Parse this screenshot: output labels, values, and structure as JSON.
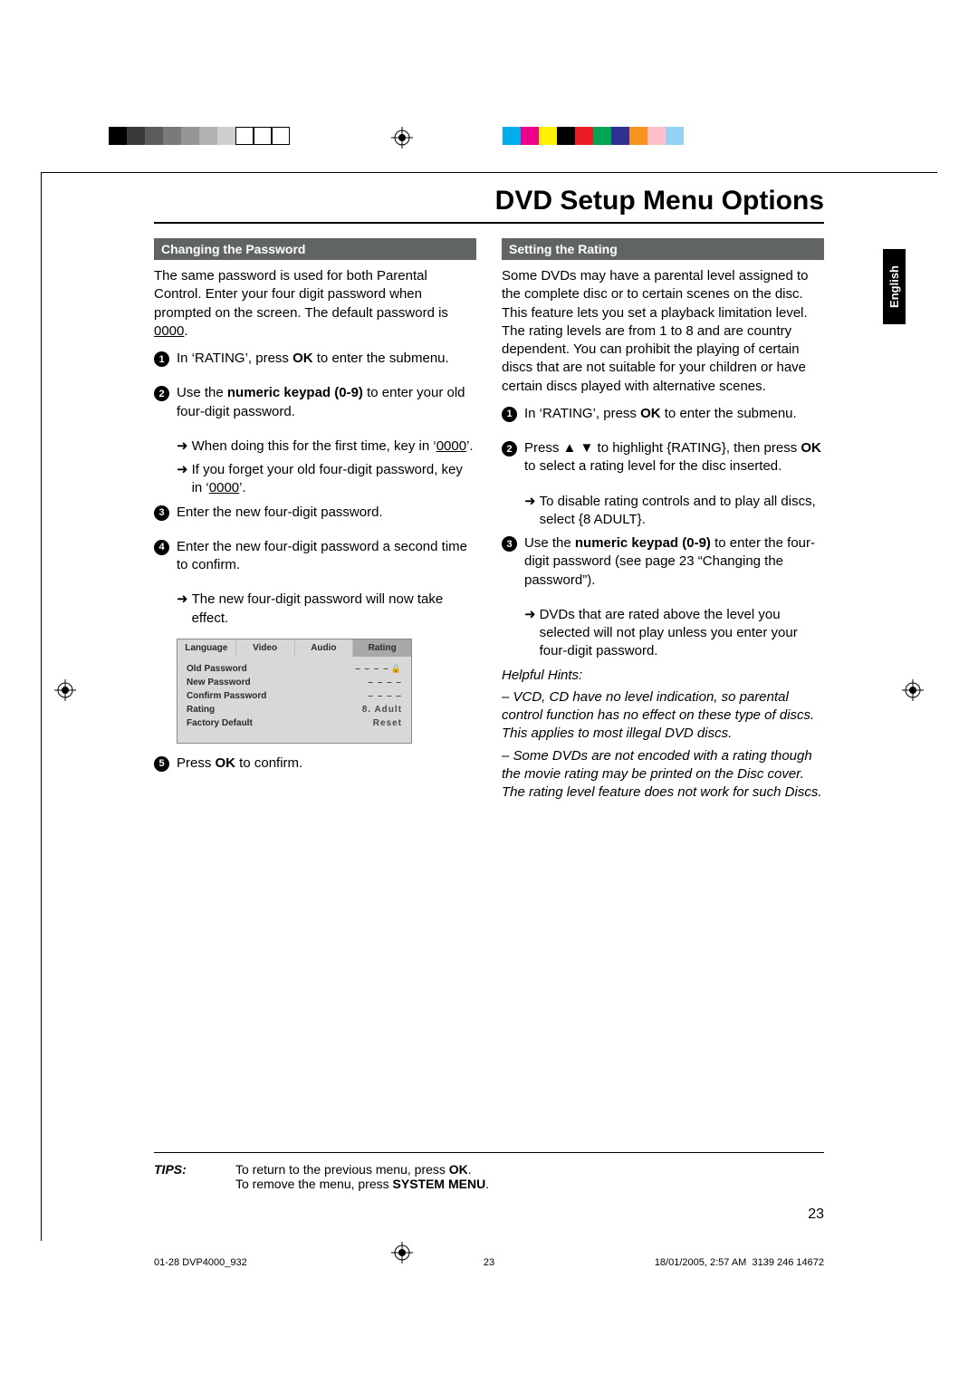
{
  "title": "DVD Setup Menu Options",
  "language_tab": "English",
  "left": {
    "heading": "Changing the Password",
    "intro_a": "The same password is used for both Parental Control. Enter your four digit password when prompted on the screen. The default password is ",
    "intro_default": "0000",
    "intro_b": ".",
    "step1_a": "In ‘RATING’, press ",
    "step1_ok": "OK",
    "step1_b": " to enter the submenu.",
    "step2_a": "Use the ",
    "step2_bold": "numeric keypad (0-9)",
    "step2_b": " to enter your old four-digit password.",
    "step2_sub1_a": "When doing this for the first time, key in ‘",
    "step2_sub1_u": "0000",
    "step2_sub1_b": "’.",
    "step2_sub2_a": "If you forget your old four-digit password, key in ‘",
    "step2_sub2_u": "0000",
    "step2_sub2_b": "’.",
    "step3": "Enter the new four-digit password.",
    "step4": "Enter the new four-digit password a second time to confirm.",
    "step4_sub": "The new four-digit password will now take effect.",
    "step5_a": "Press ",
    "step5_ok": "OK",
    "step5_b": " to confirm."
  },
  "osd": {
    "tabs": [
      "Language",
      "Video",
      "Audio",
      "Rating"
    ],
    "rows": [
      {
        "k": "Old Password",
        "v": "– – – –",
        "lock": true
      },
      {
        "k": "New Password",
        "v": "– – – –"
      },
      {
        "k": "Confirm Password",
        "v": "– – – –"
      },
      {
        "k": "Rating",
        "v": "8. Adult"
      },
      {
        "k": "Factory Default",
        "v": "Reset"
      }
    ]
  },
  "right": {
    "heading": "Setting the Rating",
    "intro": "Some DVDs may have a parental level assigned to the complete disc or to certain scenes on the disc. This feature lets you set a playback limitation level. The rating levels are from 1 to 8 and are country dependent. You can prohibit the playing of certain discs that are not suitable for your children or have certain discs played with alternative scenes.",
    "step1_a": "In ‘RATING’, press ",
    "step1_ok": "OK",
    "step1_b": " to enter the submenu.",
    "step2_a": "Press ▲ ▼ to highlight {RATING}, then press ",
    "step2_ok": "OK",
    "step2_b": " to select a rating level for the disc inserted.",
    "step2_sub": "To disable rating controls and to play all discs, select {8 ADULT}.",
    "step3_a": "Use the ",
    "step3_bold": "numeric keypad (0-9)",
    "step3_b": " to enter the four-digit password (see page 23 “Changing the password”).",
    "step3_sub": "DVDs that are rated above the level you selected will not play unless you enter your four-digit password.",
    "hints_title": "Helpful Hints:",
    "hints1": "–   VCD, CD have no level indication, so parental control function has no effect on these type of discs. This applies to most illegal DVD discs.",
    "hints2": "–   Some DVDs are not encoded with a rating though the movie rating may be printed on the Disc cover. The rating level feature does not work for such Discs."
  },
  "tips": {
    "label": "TIPS:",
    "line1_a": "To return to the previous menu, press ",
    "line1_b": "OK",
    "line1_c": ".",
    "line2_a": "To remove the menu, press ",
    "line2_b": "SYSTEM MENU",
    "line2_c": "."
  },
  "page_number": "23",
  "footer": {
    "left": "01-28 DVP4000_932",
    "mid": "23",
    "right_a": "18/01/2005, 2:57 AM",
    "right_b": "3139 246 14672"
  },
  "swatches1": [
    "#000",
    "#3a3a3a",
    "#5c5c5c",
    "#7a7a7a",
    "#969696",
    "#b2b2b2",
    "#cfcfcf",
    "#ffffff",
    "#ffffff",
    "#ffffff"
  ],
  "swatches2": [
    "#00aeef",
    "#ec008c",
    "#fff200",
    "#000000",
    "#ed1c24",
    "#00a651",
    "#2e3192",
    "#f7941d",
    "#ffc0cb",
    "#92d3f5"
  ]
}
